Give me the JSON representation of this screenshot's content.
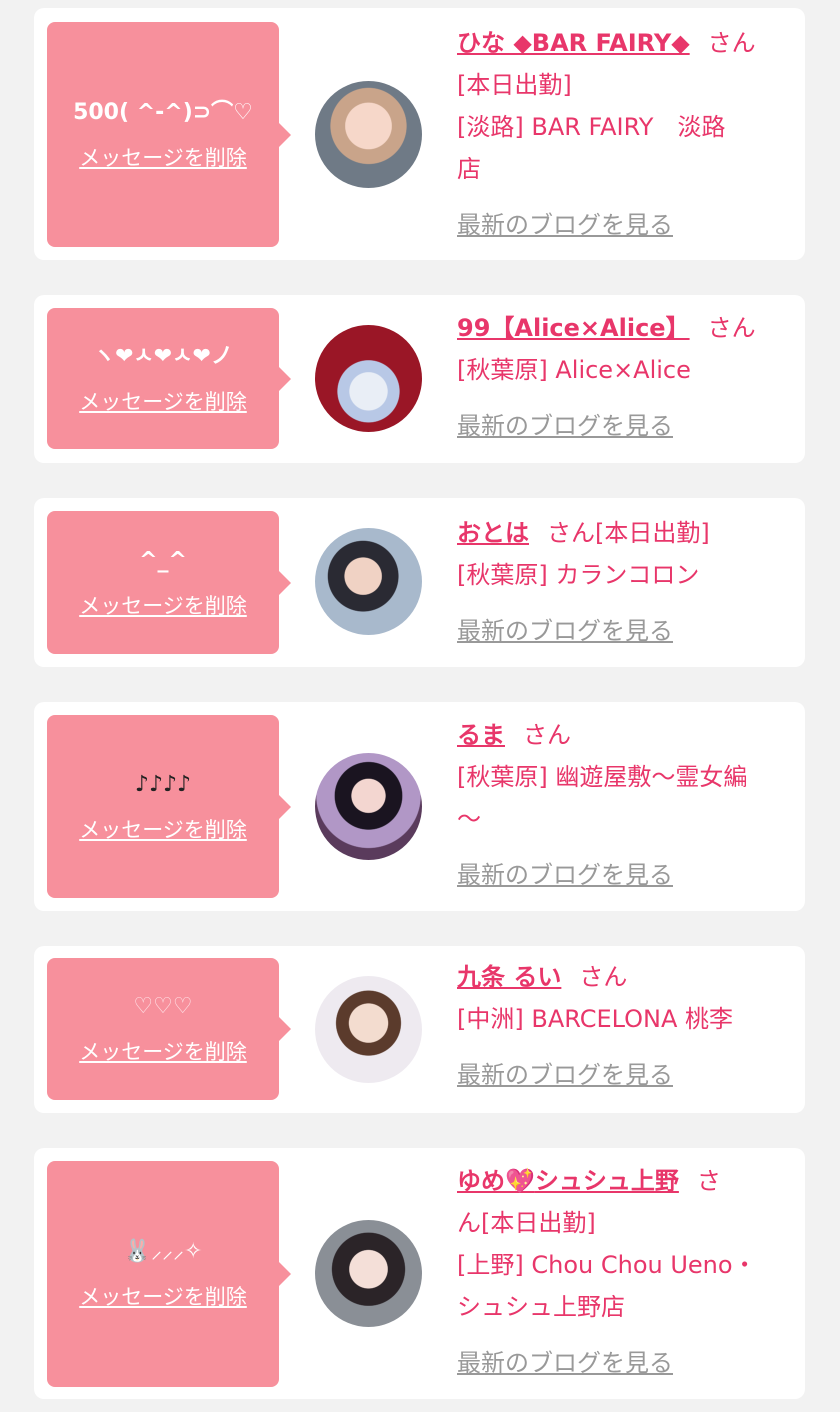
{
  "common": {
    "delete_label": "メッセージを削除",
    "honorific": "さん",
    "blog_label": "最新のブログを見る",
    "status_today": "[本日出勤]"
  },
  "colors": {
    "accent": "#e8366a",
    "bubble": "#f7909c",
    "background": "#f2f2f2",
    "link_gray": "#999999"
  },
  "cards": [
    {
      "message": "500( ^-^)⊃⌒♡",
      "name": "ひな ◆BAR FAIRY◆",
      "status": "[本日出勤]",
      "shop_line1": "[淡路] BAR FAIRY　淡路",
      "shop_line2": "店"
    },
    {
      "message": "ヽ❤︎ㅅ❤︎ㅅ❤︎ノ",
      "name": "99【Alice×Alice】",
      "shop_line1": "[秋葉原] Alice×Alice"
    },
    {
      "message": "^_^",
      "name": "おとは",
      "status": "[本日出勤]",
      "shop_line1": "[秋葉原] カランコロン"
    },
    {
      "message": "♪♪♪♪",
      "name": "るま",
      "shop_line1": "[秋葉原] 幽遊屋敷〜霊女編",
      "shop_line2": "〜"
    },
    {
      "message": "♡♡♡",
      "name": "九条 るい",
      "shop_line1": "[中洲] BARCELONA 桃李"
    },
    {
      "message": "🐰⸝⸝⸝✧",
      "name_part1": "ゆめ",
      "name_emoji": "💖",
      "name_part2": "シュシュ上野",
      "san_part1": "さ",
      "san_part2": "ん",
      "status": "[本日出勤]",
      "shop_line1": "[上野] Chou Chou Ueno・",
      "shop_line2": "シュシュ上野店"
    }
  ]
}
